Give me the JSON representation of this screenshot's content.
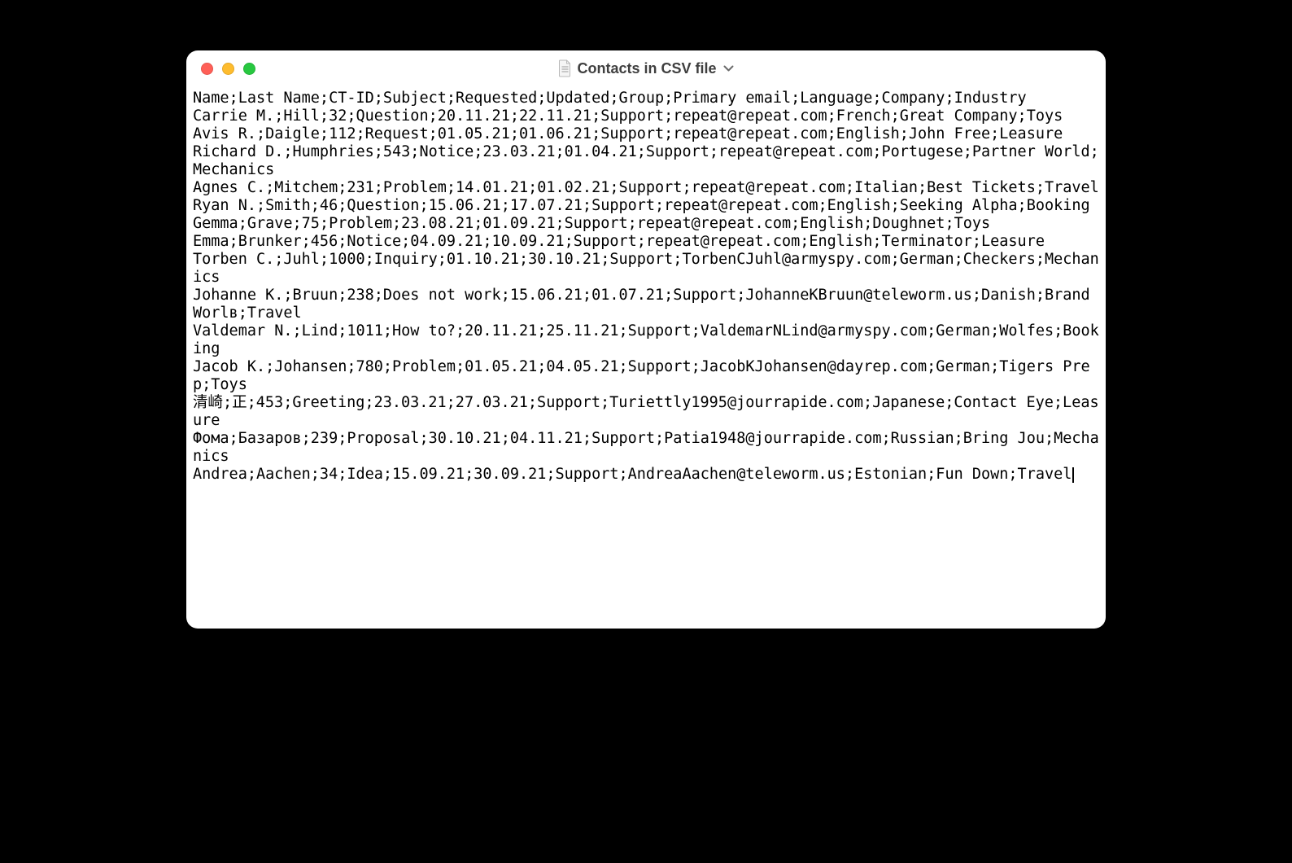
{
  "window": {
    "title": "Contacts in CSV file"
  },
  "csv": {
    "header": "Name;Last Name;CT-ID;Subject;Requested;Updated;Group;Primary email;Language;Company;Industry",
    "rows": [
      "Carrie M.;Hill;32;Question;20.11.21;22.11.21;Support;repeat@repeat.com;French;Great Company;Toys",
      "Avis R.;Daigle;112;Request;01.05.21;01.06.21;Support;repeat@repeat.com;English;John Free;Leasure",
      "Richard D.;Humphries;543;Notice;23.03.21;01.04.21;Support;repeat@repeat.com;Portugese;Partner World;Mechanics",
      "Agnes C.;Mitchem;231;Problem;14.01.21;01.02.21;Support;repeat@repeat.com;Italian;Best Tickets;Travel",
      "Ryan N.;Smith;46;Question;15.06.21;17.07.21;Support;repeat@repeat.com;English;Seeking Alpha;Booking",
      "Gemma;Grave;75;Problem;23.08.21;01.09.21;Support;repeat@repeat.com;English;Doughnet;Toys",
      "Emma;Brunker;456;Notice;04.09.21;10.09.21;Support;repeat@repeat.com;English;Terminator;Leasure",
      "Torben C.;Juhl;1000;Inquiry;01.10.21;30.10.21;Support;TorbenCJuhl@armyspy.com;German;Checkers;Mechanics",
      "Johanne K.;Bruun;238;Does not work;15.06.21;01.07.21;Support;JohanneKBruun@teleworm.us;Danish;Brand Worlв;Travel",
      "Valdemar N.;Lind;1011;How to?;20.11.21;25.11.21;Support;ValdemarNLind@armyspy.com;German;Wolfes;Booking",
      "Jacob K.;Johansen;780;Problem;01.05.21;04.05.21;Support;JacobKJohansen@dayrep.com;German;Tigers Prep;Toys",
      "清崎;正;453;Greeting;23.03.21;27.03.21;Support;Turiettly1995@jourrapide.com;Japanese;Contact Eye;Leasure",
      "Фома;Базаров;239;Proposal;30.10.21;04.11.21;Support;Patia1948@jourrapide.com;Russian;Bring Jou;Mechanics",
      "Andrea;Aachen;34;Idea;15.09.21;30.09.21;Support;AndreaAachen@teleworm.us;Estonian;Fun Down;Travel"
    ]
  }
}
